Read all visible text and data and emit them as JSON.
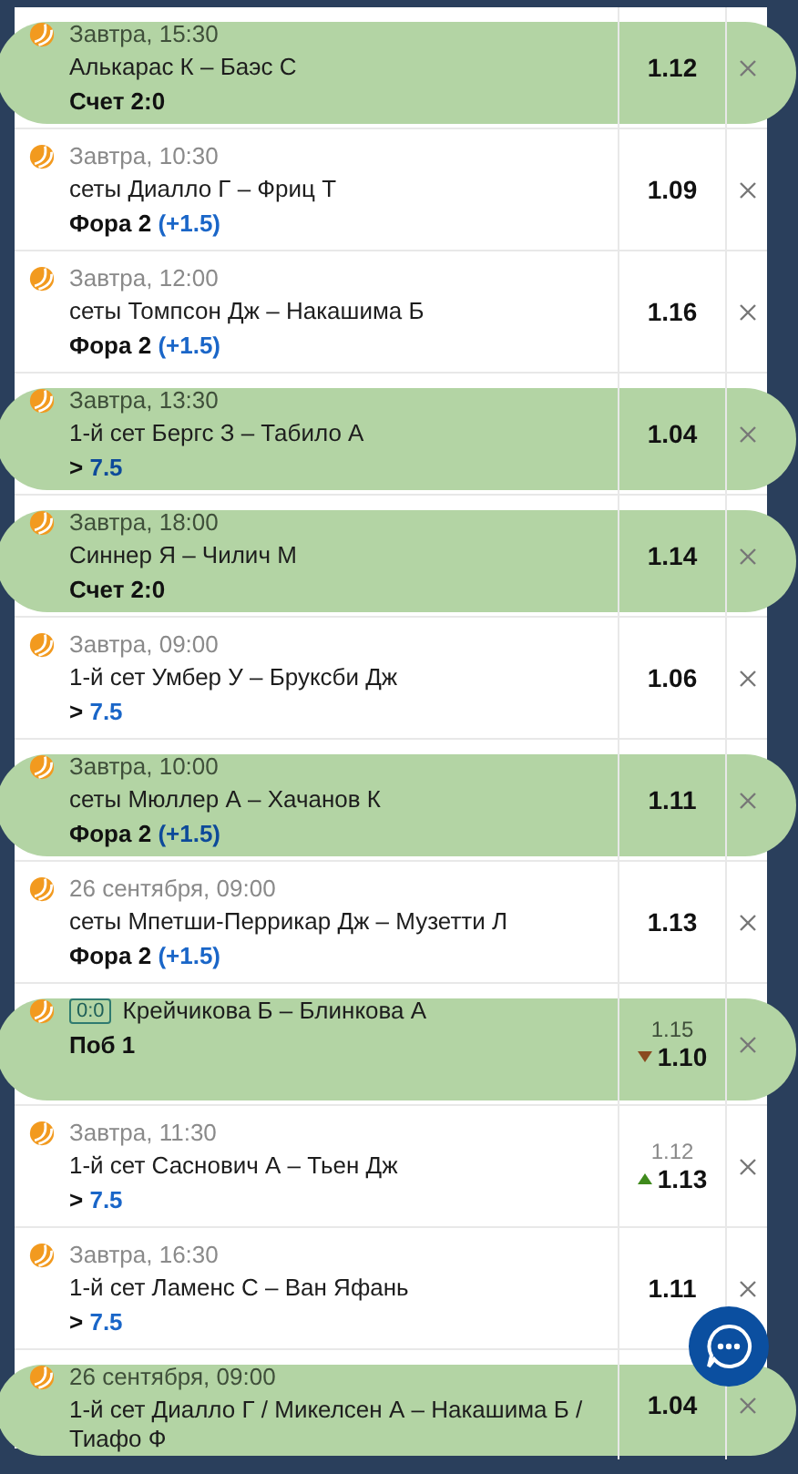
{
  "bets": [
    {
      "time": "Завтра, 15:30",
      "match": "Алькарас К – Баэс С",
      "bet": "Счет 2:0",
      "odds": "1.12",
      "highlighted": true
    },
    {
      "time": "Завтра, 10:30",
      "match": "сеты Диалло Г – Фриц Т",
      "bet": "Фора 2",
      "bet_value": "(+1.5)",
      "odds": "1.09",
      "highlighted": false
    },
    {
      "time": "Завтра, 12:00",
      "match": "сеты Томпсон Дж – Накашима Б",
      "bet": "Фора 2",
      "bet_value": "(+1.5)",
      "odds": "1.16",
      "highlighted": false
    },
    {
      "time": "Завтра, 13:30",
      "match": "1-й сет Бергс З – Табило А",
      "bet": ">",
      "bet_value": "7.5",
      "odds": "1.04",
      "highlighted": true
    },
    {
      "time": "Завтра, 18:00",
      "match": "Синнер Я – Чилич М",
      "bet": "Счет 2:0",
      "odds": "1.14",
      "highlighted": true
    },
    {
      "time": "Завтра, 09:00",
      "match": "1-й сет Умбер У – Бруксби Дж",
      "bet": ">",
      "bet_value": "7.5",
      "odds": "1.06",
      "highlighted": false
    },
    {
      "time": "Завтра, 10:00",
      "match": "сеты Мюллер А – Хачанов К",
      "bet": "Фора 2",
      "bet_value": "(+1.5)",
      "odds": "1.11",
      "highlighted": true
    },
    {
      "time": "26 сентября, 09:00",
      "match": "сеты Мпетши-Перрикар Дж – Музетти Л",
      "bet": "Фора 2",
      "bet_value": "(+1.5)",
      "odds": "1.13",
      "highlighted": false
    },
    {
      "score": "0:0",
      "match": "Крейчикова Б – Блинкова А",
      "bet": "Поб 1",
      "old_odds": "1.15",
      "odds": "1.10",
      "rising": false,
      "highlighted": true
    },
    {
      "time": "Завтра, 11:30",
      "match": "1-й сет Саснович А – Тьен Дж",
      "bet": ">",
      "bet_value": "7.5",
      "old_odds": "1.12",
      "odds": "1.13",
      "rising": true,
      "highlighted": false
    },
    {
      "time": "Завтра, 16:30",
      "match": "1-й сет Ламенс С – Ван Яфань",
      "bet": ">",
      "bet_value": "7.5",
      "odds": "1.11",
      "highlighted": false
    },
    {
      "time": "26 сентября, 09:00",
      "match": "1-й сет Диалло Г / Микелсен А – Накашима Б / Тиафо Ф",
      "odds": "1.04",
      "highlighted": true
    }
  ]
}
